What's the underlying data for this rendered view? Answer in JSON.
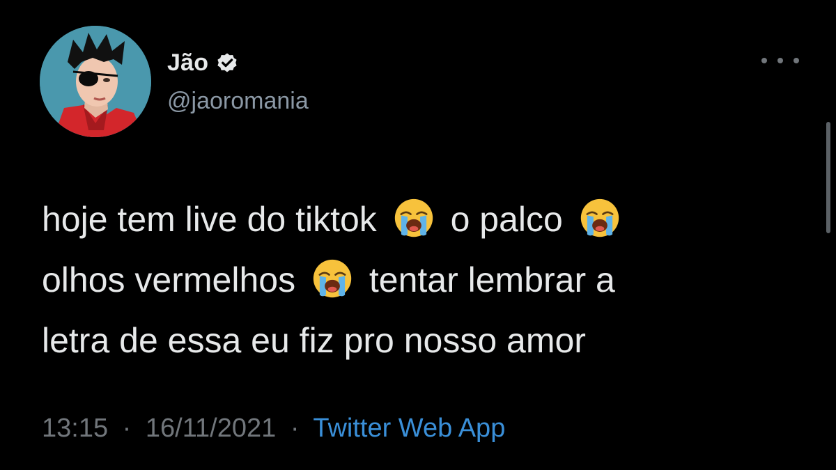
{
  "author": {
    "display_name": "Jão",
    "handle": "@jaoromania",
    "verified": true
  },
  "tweet": {
    "lines": [
      [
        "hoje tem live do tiktok",
        "o palco"
      ],
      [
        "olhos vermelhos",
        "tentar lembrar a"
      ],
      [
        "letra de essa eu fiz pro nosso amor"
      ]
    ],
    "emoji_name": "loudly-crying-face-icon"
  },
  "meta": {
    "time": "13:15",
    "date": "16/11/2021",
    "separator": "·",
    "source": "Twitter Web App"
  },
  "colors": {
    "background": "#000000",
    "text": "#e7e9ea",
    "secondary": "#8b98a5",
    "link": "#3a8fd8"
  }
}
